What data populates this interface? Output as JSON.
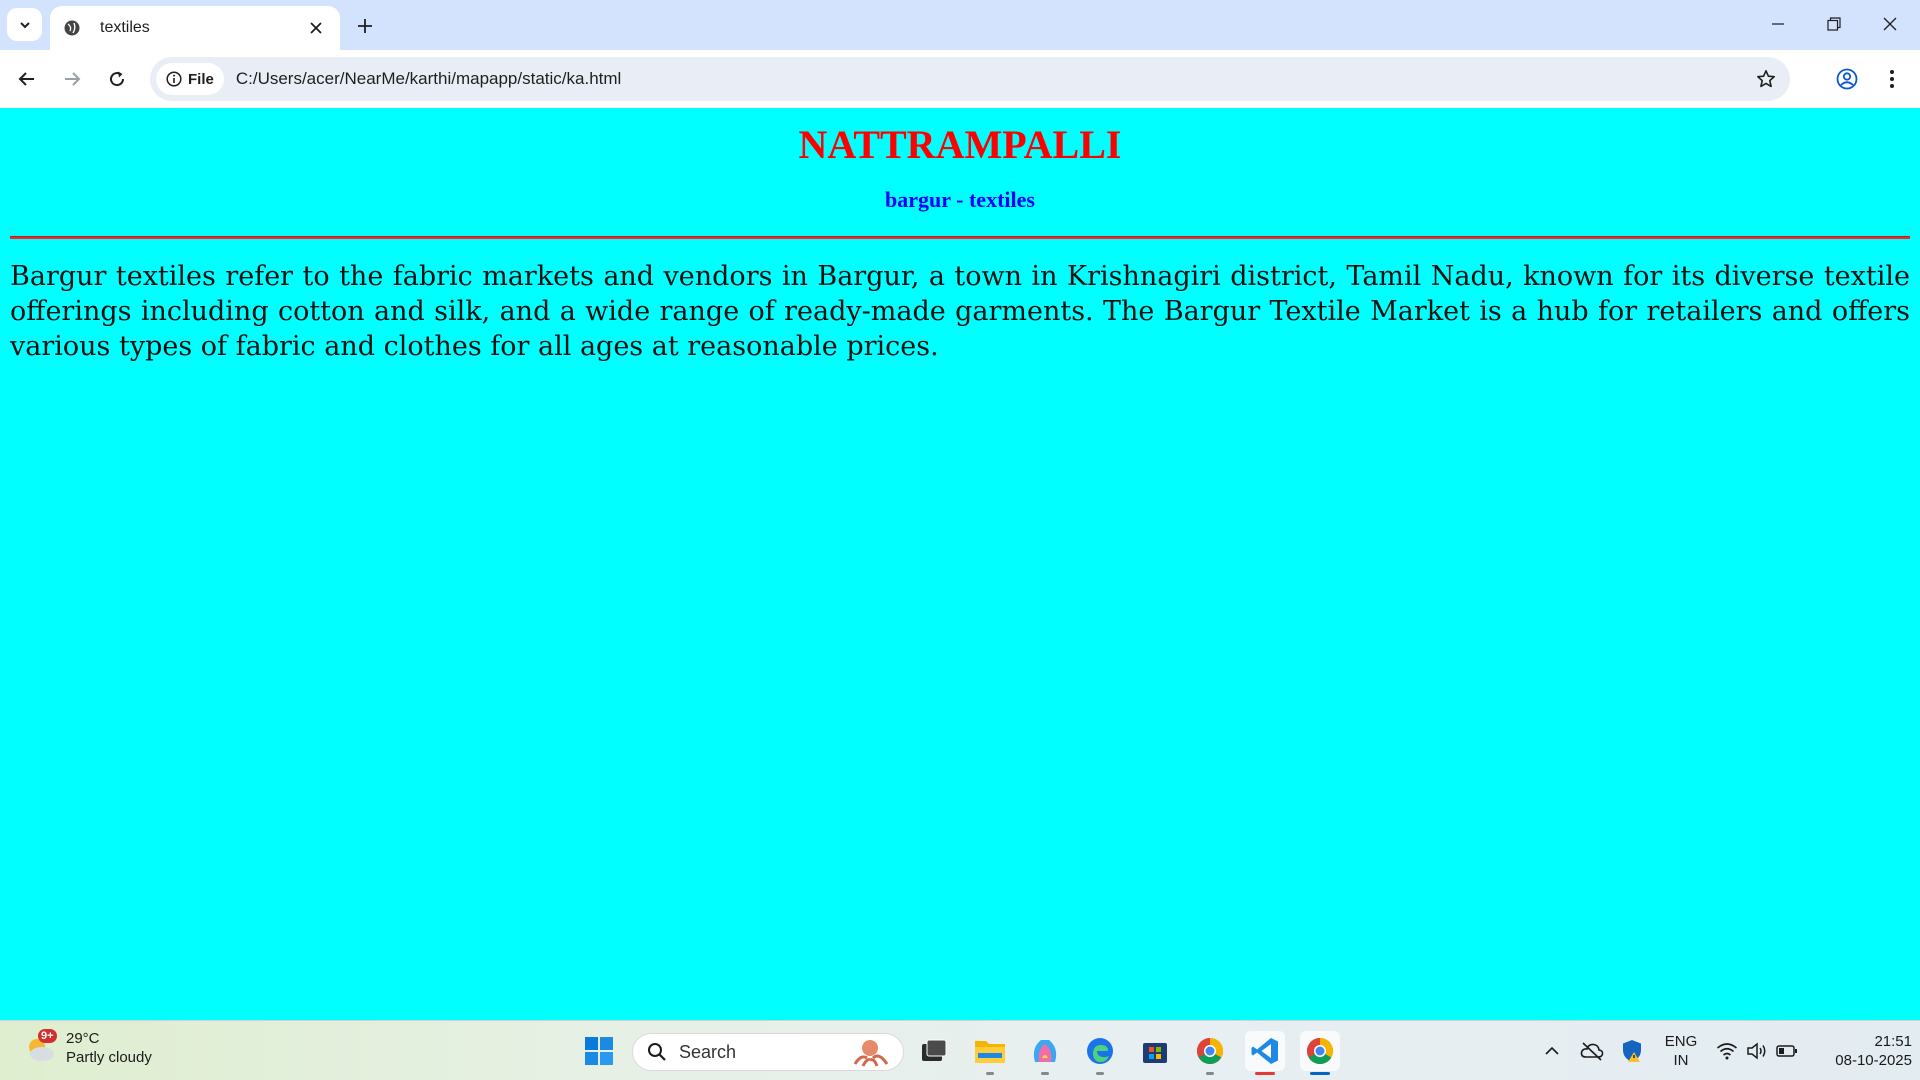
{
  "browser": {
    "tab_title": "textiles",
    "address_chip": "File",
    "url": "C:/Users/acer/NearMe/karthi/mapapp/static/ka.html"
  },
  "page": {
    "heading": "NATTRAMPALLI",
    "subheading": "bargur - textiles",
    "paragraph": "Bargur textiles refer to the fabric markets and vendors in Bargur, a town in Krishnagiri district, Tamil Nadu, known for its diverse textile offerings including cotton and silk, and a wide range of ready-made garments. The Bargur Textile Market is a hub for retailers and offers various types of fabric and clothes for all ages at reasonable prices.",
    "background_color": "#00ffff",
    "heading_color": "#ff0000",
    "subheading_color": "#0000ff"
  },
  "taskbar": {
    "weather_badge": "9+",
    "temperature": "29°C",
    "condition": "Partly cloudy",
    "search_placeholder": "Search",
    "language_line1": "ENG",
    "language_line2": "IN",
    "time": "21:51",
    "date": "08-10-2025"
  }
}
